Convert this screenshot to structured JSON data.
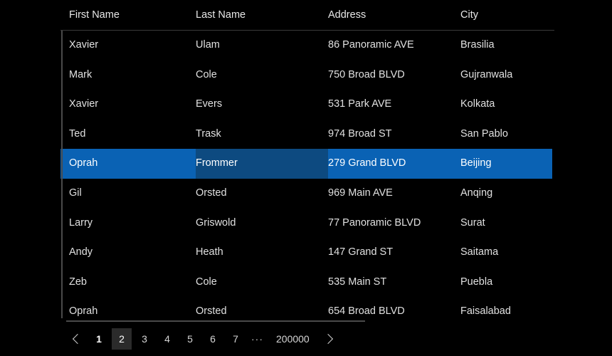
{
  "grid": {
    "columns": [
      {
        "key": "first_name",
        "label": "First Name"
      },
      {
        "key": "last_name",
        "label": "Last Name"
      },
      {
        "key": "address",
        "label": "Address"
      },
      {
        "key": "city",
        "label": "City"
      }
    ],
    "rows": [
      {
        "first_name": "Xavier",
        "last_name": "Ulam",
        "address": "86 Panoramic AVE",
        "city": "Brasilia",
        "selected": false,
        "focused_column": null
      },
      {
        "first_name": "Mark",
        "last_name": "Cole",
        "address": "750 Broad BLVD",
        "city": "Gujranwala",
        "selected": false,
        "focused_column": null
      },
      {
        "first_name": "Xavier",
        "last_name": "Evers",
        "address": "531 Park AVE",
        "city": "Kolkata",
        "selected": false,
        "focused_column": null
      },
      {
        "first_name": "Ted",
        "last_name": "Trask",
        "address": "974 Broad ST",
        "city": "San Pablo",
        "selected": false,
        "focused_column": null
      },
      {
        "first_name": "Oprah",
        "last_name": "Frommer",
        "address": "279 Grand BLVD",
        "city": "Beijing",
        "selected": true,
        "focused_column": 1
      },
      {
        "first_name": "Gil",
        "last_name": "Orsted",
        "address": "969 Main AVE",
        "city": "Anqing",
        "selected": false,
        "focused_column": null
      },
      {
        "first_name": "Larry",
        "last_name": "Griswold",
        "address": "77 Panoramic BLVD",
        "city": "Surat",
        "selected": false,
        "focused_column": null
      },
      {
        "first_name": "Andy",
        "last_name": "Heath",
        "address": "147 Grand ST",
        "city": "Saitama",
        "selected": false,
        "focused_column": null
      },
      {
        "first_name": "Zeb",
        "last_name": "Cole",
        "address": "535 Main ST",
        "city": "Puebla",
        "selected": false,
        "focused_column": null
      },
      {
        "first_name": "Oprah",
        "last_name": "Orsted",
        "address": "654 Broad BLVD",
        "city": "Faisalabad",
        "selected": false,
        "focused_column": null
      }
    ]
  },
  "pager": {
    "previous_label": "‹",
    "next_label": "›",
    "ellipsis_label": "···",
    "current_page": "2",
    "pages": [
      "1",
      "2",
      "3",
      "4",
      "5",
      "6",
      "7"
    ],
    "last_page": "200000"
  },
  "colors": {
    "background": "#000000",
    "accent_selection": "#0a62b4",
    "cell_focus": "#0d4a80",
    "current_page_chip": "#2b2b2b",
    "separator": "#3a3a3a",
    "scrollbar": "#4a4a4a",
    "text": "#e0e0e0"
  }
}
